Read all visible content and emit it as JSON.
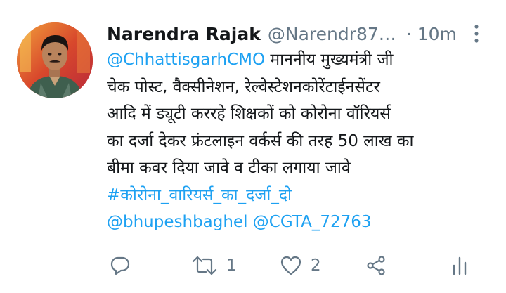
{
  "tweet": {
    "author_name": "Narendra Rajak",
    "handle": "@Narendr87…",
    "separator": "·",
    "time": "10m",
    "body": {
      "mention_cmo": "@ChhattisgarhCMO",
      "line1_text": " माननीय मुख्यमंत्री जी",
      "line2": "चेक पोस्ट, वैक्सीनेशन, रेल्वेस्टेशनकोरेंटाईनसेंटर",
      "line3": "आदि में ड्यूटी कररहे शिक्षकों को कोरोना वॉरियर्स",
      "line4": "का दर्जा देकर फ्रंटलाइन वर्कर्स की तरह 50 लाख का",
      "line5": "बीमा कवर दिया जावे व टीका लगाया जावे",
      "hashtag": "#कोरोना_वारियर्स_का_दर्जा_दो",
      "mention_bhupesh": "@bhupeshbaghel",
      "mention_cgta": "@CGTA_72763"
    },
    "actions": {
      "reply_icon": "reply-icon",
      "retweet_icon": "retweet-icon",
      "retweet_count": "1",
      "like_icon": "heart-icon",
      "like_count": "2",
      "share_icon": "share-icon",
      "analytics_icon": "analytics-icon"
    },
    "colors": {
      "link": "#1da1f2",
      "text": "#14171a",
      "muted": "#657786"
    }
  }
}
